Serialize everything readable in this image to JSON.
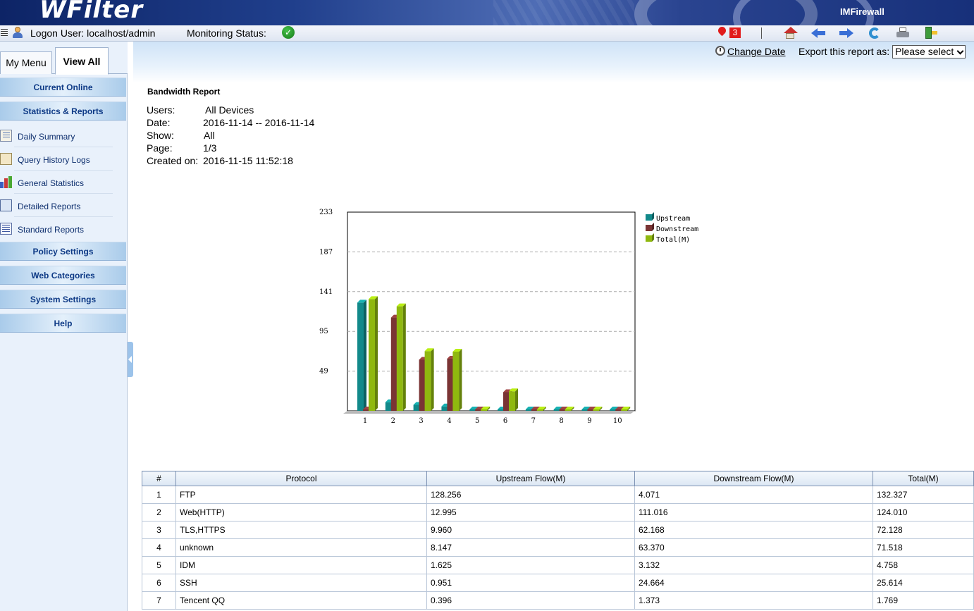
{
  "header": {
    "logo": "WFilter",
    "product": "IMFirewall"
  },
  "status": {
    "logon": "Logon User: localhost/admin",
    "monitoring": "Monitoring Status:",
    "alert_count": "3"
  },
  "sidebar": {
    "tabs": [
      {
        "label": "My Menu"
      },
      {
        "label": "View All"
      }
    ],
    "categories": {
      "current_online": "Current Online",
      "statistics": "Statistics & Reports",
      "policy": "Policy Settings",
      "web_categories": "Web Categories",
      "system": "System Settings",
      "help": "Help"
    },
    "sub_items": [
      {
        "label": "Daily Summary",
        "icon": "daily-summary-icon"
      },
      {
        "label": "Query History Logs",
        "icon": "query-history-icon"
      },
      {
        "label": "General Statistics",
        "icon": "bar-chart-icon"
      },
      {
        "label": "Detailed Reports",
        "icon": "detailed-report-icon"
      },
      {
        "label": "Standard Reports",
        "icon": "standard-report-icon"
      }
    ]
  },
  "toolbar": {
    "change_date": "Change Date",
    "export_label": "Export this report as:",
    "export_selected": "Please select"
  },
  "report": {
    "title": "Bandwidth Report",
    "info": [
      {
        "key": "Users:",
        "value": "All Devices"
      },
      {
        "key": "Date:",
        "value": "2016-11-14 -- 2016-11-14"
      },
      {
        "key": "Show:",
        "value": "All"
      },
      {
        "key": "Page:",
        "value": "1/3"
      },
      {
        "key": "Created on:",
        "value": "2016-11-15 11:52:18"
      }
    ]
  },
  "chart_data": {
    "type": "bar",
    "categories": [
      "1",
      "2",
      "3",
      "4",
      "5",
      "6",
      "7",
      "8",
      "9",
      "10"
    ],
    "series": [
      {
        "name": "Upstream",
        "color": "#12898a",
        "values": [
          128.256,
          12.995,
          9.96,
          8.147,
          1.625,
          0.951,
          0.396,
          0.3,
          0.25,
          0.2
        ]
      },
      {
        "name": "Downstream",
        "color": "#7a3434",
        "values": [
          4.071,
          111.016,
          62.168,
          63.37,
          3.132,
          24.664,
          1.373,
          0.9,
          0.8,
          0.7
        ]
      },
      {
        "name": "Total(M)",
        "color": "#8fb80f",
        "values": [
          132.327,
          124.01,
          72.128,
          71.518,
          4.758,
          25.614,
          1.769,
          1.2,
          1.05,
          0.9
        ]
      }
    ],
    "yticks": [
      "233",
      "187",
      "141",
      "95",
      "49"
    ],
    "ylim": [
      3,
      233
    ],
    "grid": true,
    "legend": "right"
  },
  "table": {
    "columns": [
      "#",
      "Protocol",
      "Upstream Flow(M)",
      "Downstream Flow(M)",
      "Total(M)"
    ],
    "rows": [
      [
        "1",
        "FTP",
        "128.256",
        "4.071",
        "132.327"
      ],
      [
        "2",
        "Web(HTTP)",
        "12.995",
        "111.016",
        "124.010"
      ],
      [
        "3",
        "TLS,HTTPS",
        "9.960",
        "62.168",
        "72.128"
      ],
      [
        "4",
        "unknown",
        "8.147",
        "63.370",
        "71.518"
      ],
      [
        "5",
        "IDM",
        "1.625",
        "3.132",
        "4.758"
      ],
      [
        "6",
        "SSH",
        "0.951",
        "24.664",
        "25.614"
      ],
      [
        "7",
        "Tencent QQ",
        "0.396",
        "1.373",
        "1.769"
      ]
    ]
  }
}
